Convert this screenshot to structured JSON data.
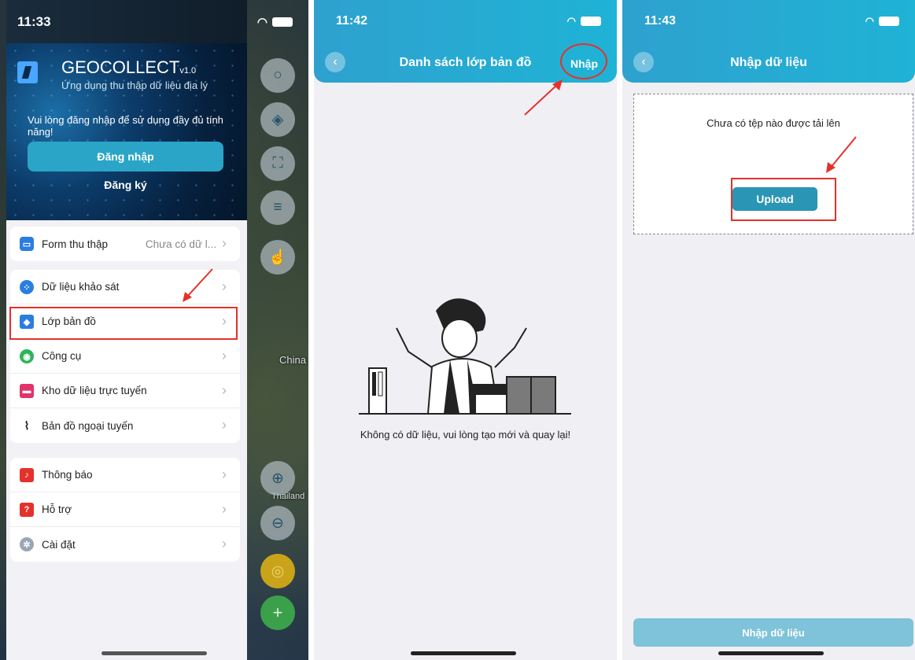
{
  "screen1": {
    "status_time": "11:33",
    "app_title": "GEOCOLLECT",
    "app_version": "v1.0",
    "app_subtitle": "Ứng dụng thu thập dữ liệu địa lý",
    "login_note": "Vui lòng đăng nhập để sử dụng đầy đủ tính năng!",
    "login_button": "Đăng nhập",
    "register_button": "Đăng ký",
    "form_row": {
      "label": "Form thu thập",
      "value": "Chưa có dữ l..."
    },
    "menu_group1": [
      {
        "label": "Dữ liệu khảo sát",
        "icon": "grid-icon"
      },
      {
        "label": "Lớp bản đồ",
        "icon": "layers-icon"
      },
      {
        "label": "Công cụ",
        "icon": "eye-icon"
      },
      {
        "label": "Kho dữ liệu trực tuyến",
        "icon": "store-icon"
      },
      {
        "label": "Bản đồ ngoại tuyến",
        "icon": "wifi-off-icon"
      }
    ],
    "menu_group2": [
      {
        "label": "Thông báo",
        "icon": "bell-icon"
      },
      {
        "label": "Hỗ trợ",
        "icon": "help-icon"
      },
      {
        "label": "Cài đặt",
        "icon": "settings-icon"
      }
    ],
    "map_labels": [
      "China",
      "Thailand"
    ]
  },
  "screen2": {
    "status_time": "11:42",
    "title": "Danh sách lớp bản đồ",
    "action": "Nhập",
    "empty_message": "Không có dữ liệu, vui lòng tạo mới và quay lại!"
  },
  "screen3": {
    "status_time": "11:43",
    "title": "Nhập dữ liệu",
    "drop_text": "Chưa có tệp nào được tải lên",
    "upload_button": "Upload",
    "import_button": "Nhập dữ liệu"
  },
  "colors": {
    "accent": "#2aa5c8",
    "highlight": "#e5312b"
  }
}
